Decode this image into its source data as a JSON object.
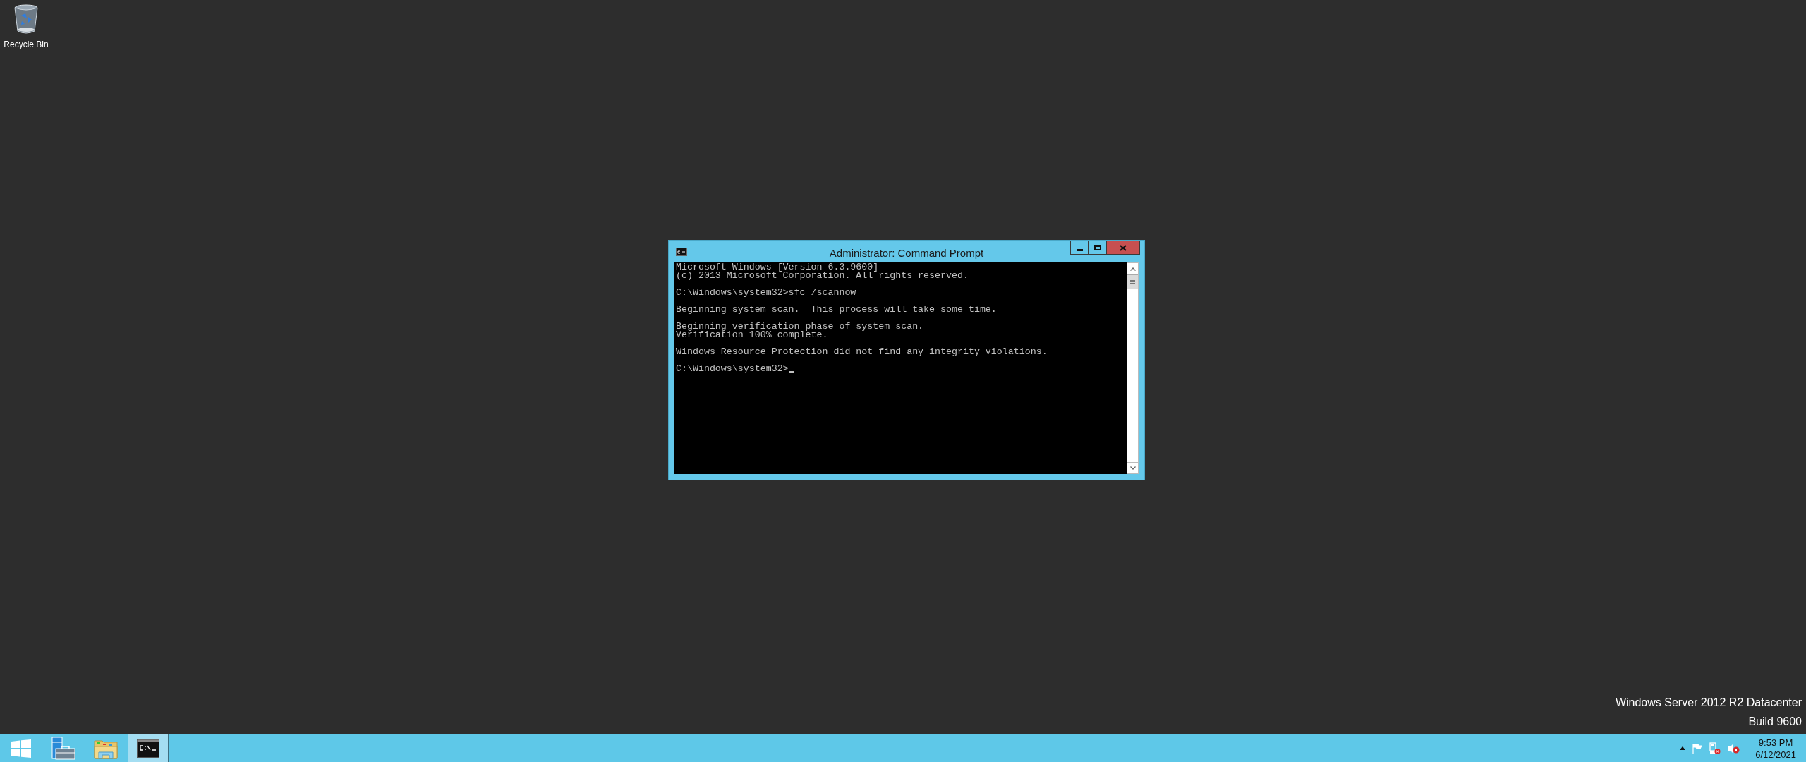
{
  "desktop": {
    "icons": [
      {
        "label": "Recycle Bin"
      }
    ]
  },
  "window": {
    "title": "Administrator: Command Prompt",
    "active": true,
    "console": {
      "blocks": [
        [
          "Microsoft Windows [Version 6.3.9600]",
          "(c) 2013 Microsoft Corporation. All rights reserved."
        ],
        [
          "C:\\Windows\\system32>sfc /scannow"
        ],
        [
          "Beginning system scan.  This process will take some time."
        ],
        [
          "Beginning verification phase of system scan.",
          "Verification 100% complete."
        ],
        [
          "Windows Resource Protection did not find any integrity violations."
        ],
        [
          "C:\\Windows\\system32>"
        ]
      ],
      "cursor": true
    }
  },
  "edition": [
    "Windows Server 2012 R2 Datacenter",
    "Build 9600"
  ],
  "taskbar": {
    "items": [
      {
        "kind": "start",
        "selected": false
      },
      {
        "kind": "server-manager",
        "selected": false
      },
      {
        "kind": "explorer",
        "selected": false
      },
      {
        "kind": "console",
        "selected": true
      }
    ],
    "tray": [
      {
        "kind": "flag"
      },
      {
        "kind": "network"
      },
      {
        "kind": "speaker"
      }
    ],
    "clock": {
      "time": "9:53 PM",
      "date": "6/12/2021"
    }
  }
}
